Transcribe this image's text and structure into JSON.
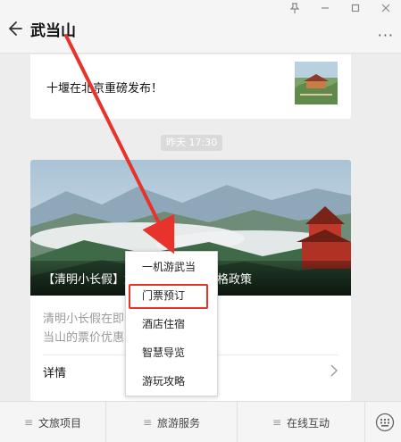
{
  "window": {
    "controls": [
      "pin-icon",
      "minimize-icon",
      "maximize-icon",
      "close-icon"
    ]
  },
  "header": {
    "title": "武当山",
    "more_label": "···"
  },
  "chat": {
    "prev_article_title": "十堰在北京重磅发布！",
    "timestamp": "昨天 17:30",
    "article": {
      "banner_caption": "【清明小长假】武当山景区门票价格政策",
      "banner_caption_visible_left": "【清明小长假",
      "banner_caption_visible_right": "当山票价政策",
      "description_line1": "清明小长假在即，行小编整理了武",
      "description_line2": "当山的票价优惠",
      "details_label": "详情"
    }
  },
  "popup_menu": {
    "items": [
      "一机游武当",
      "门票预订",
      "酒店住宿",
      "智慧导览",
      "游玩攻略"
    ],
    "highlighted_item": "门票预订",
    "highlight_color": "#e8322c"
  },
  "bottom_menu": {
    "items": [
      "文旅项目",
      "旅游服务",
      "在线互动"
    ]
  }
}
